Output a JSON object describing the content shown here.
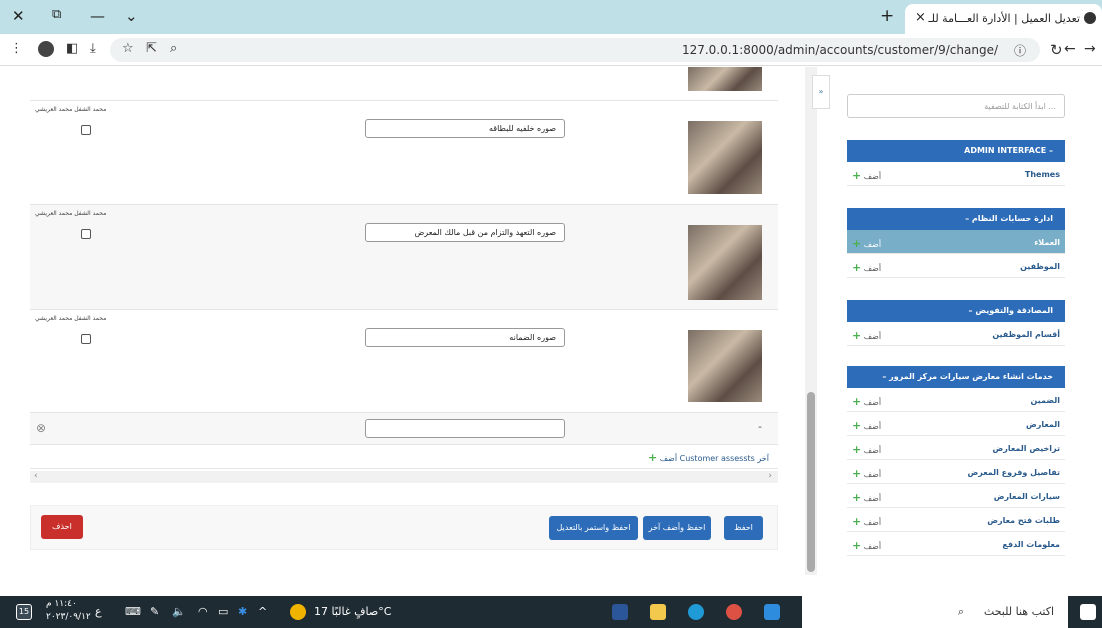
{
  "browser": {
    "tab_title": "تعديل العميل | الأدارة العـــامة للـ",
    "tab_close": "×",
    "new_tab": "+",
    "url": "127.0.0.1:8000/admin/accounts/customer/9/change/",
    "window_controls": {
      "close": "✕",
      "restore": "⧉",
      "minimize": "—",
      "menu": "⌄"
    }
  },
  "inline_rows": [
    {
      "owner": "محمد الشفل محمد العريشي",
      "description": "صوره خلفيه للبطاقه"
    },
    {
      "owner": "محمد الشفل محمد العريشي",
      "description": "صوره التعهد والتزام من قبل مالك المعرض"
    },
    {
      "owner": "محمد الشفل محمد العريشي",
      "description": "صوره الضمانه"
    }
  ],
  "empty_row": {
    "dash": "-",
    "remove_icon": "⊗",
    "value": ""
  },
  "add_another": {
    "label": "أضف Customer assessts آخر",
    "icon": "+"
  },
  "scroll_arrows": {
    "left": "‹",
    "right": "›"
  },
  "actions": {
    "save": "احفظ",
    "save_add": "احفظ وأضف آخر",
    "save_continue": "احفظ واستمر بالتعديل",
    "delete": "احذف"
  },
  "sidebar": {
    "toggle": "»",
    "filter_placeholder": "ابدأ الكتابة للتصفية ...",
    "add_label": "أضف",
    "modules": [
      {
        "caption": "ADMIN INTERFACE  –",
        "items": [
          "Themes"
        ]
      },
      {
        "caption": "–   ادارة حسابات النظام",
        "items": [
          "العملاء",
          "الموظفين"
        ]
      },
      {
        "caption": "–   المصادقة والتفويض",
        "items": [
          "أقسام الموظفين"
        ]
      },
      {
        "caption": "–   خدمات انشاء معارض سيارات مركز المرور",
        "items": [
          "الضمين",
          "المعارض",
          "تراخيص المعارض",
          "تفاصيل وفروع المعرض",
          "سيارات المعارض",
          "طلبات فتح معارض",
          "معلومات الدفع"
        ]
      }
    ]
  },
  "taskbar": {
    "search": "اكتب هنا للبحث",
    "weather": "صافٍ غالبًا  17°C",
    "time": "١١:٤٠ م",
    "date": "٢٠٢٣/٠٩/١٢",
    "lang": "ع",
    "notif": "15"
  },
  "colors": {
    "primary": "#2d6cb8",
    "danger": "#c9302c",
    "selected": "#79aec8",
    "add": "#4caf50"
  }
}
